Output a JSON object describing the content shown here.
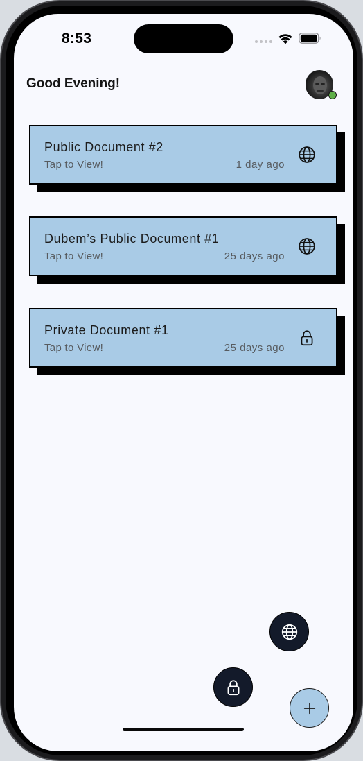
{
  "status_bar": {
    "time": "8:53"
  },
  "header": {
    "greeting": "Good Evening!",
    "avatar_icon": "user-avatar",
    "presence_color": "#5fb048"
  },
  "documents": [
    {
      "title": "Public Document #2",
      "subtitle": "Tap to View!",
      "time": "1 day ago",
      "icon": "globe-icon"
    },
    {
      "title": "Dubem’s Public Document #1",
      "subtitle": "Tap to View!",
      "time": "25 days ago",
      "icon": "globe-icon"
    },
    {
      "title": "Private Document #1",
      "subtitle": "Tap to View!",
      "time": "25 days ago",
      "icon": "lock-icon"
    }
  ],
  "fabs": {
    "public_icon": "globe-icon",
    "private_icon": "lock-icon",
    "add_icon": "plus-icon"
  },
  "colors": {
    "card_background": "#a9cbe6",
    "card_shadow": "#000000",
    "fab_dark": "#131a2a",
    "screen_background": "#f8f9fe"
  }
}
